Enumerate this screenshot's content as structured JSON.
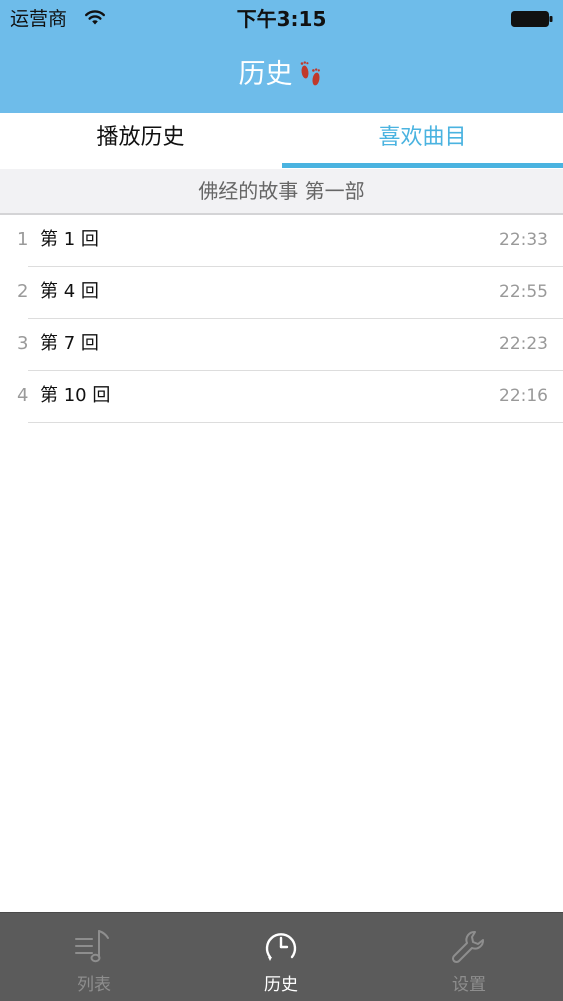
{
  "status_bar": {
    "carrier": "运营商",
    "time": "下午3:15"
  },
  "nav": {
    "title": "历史"
  },
  "tabs": [
    {
      "label": "播放历史",
      "active": false
    },
    {
      "label": "喜欢曲目",
      "active": true
    }
  ],
  "section": {
    "title": "佛经的故事 第一部"
  },
  "tracks": [
    {
      "index": "1",
      "title": "第 1 回",
      "duration": "22:33"
    },
    {
      "index": "2",
      "title": "第 4 回",
      "duration": "22:55"
    },
    {
      "index": "3",
      "title": "第 7 回",
      "duration": "22:23"
    },
    {
      "index": "4",
      "title": "第 10 回",
      "duration": "22:16"
    }
  ],
  "tabbar": [
    {
      "label": "列表",
      "icon": "music-list-icon",
      "active": false
    },
    {
      "label": "历史",
      "icon": "clock-icon",
      "active": true
    },
    {
      "label": "设置",
      "icon": "wrench-icon",
      "active": false
    }
  ],
  "colors": {
    "header_bg": "#6ebcea",
    "accent": "#4ab3e0",
    "tabbar_bg": "#5b5b5b",
    "footprint": "#c0392b"
  }
}
